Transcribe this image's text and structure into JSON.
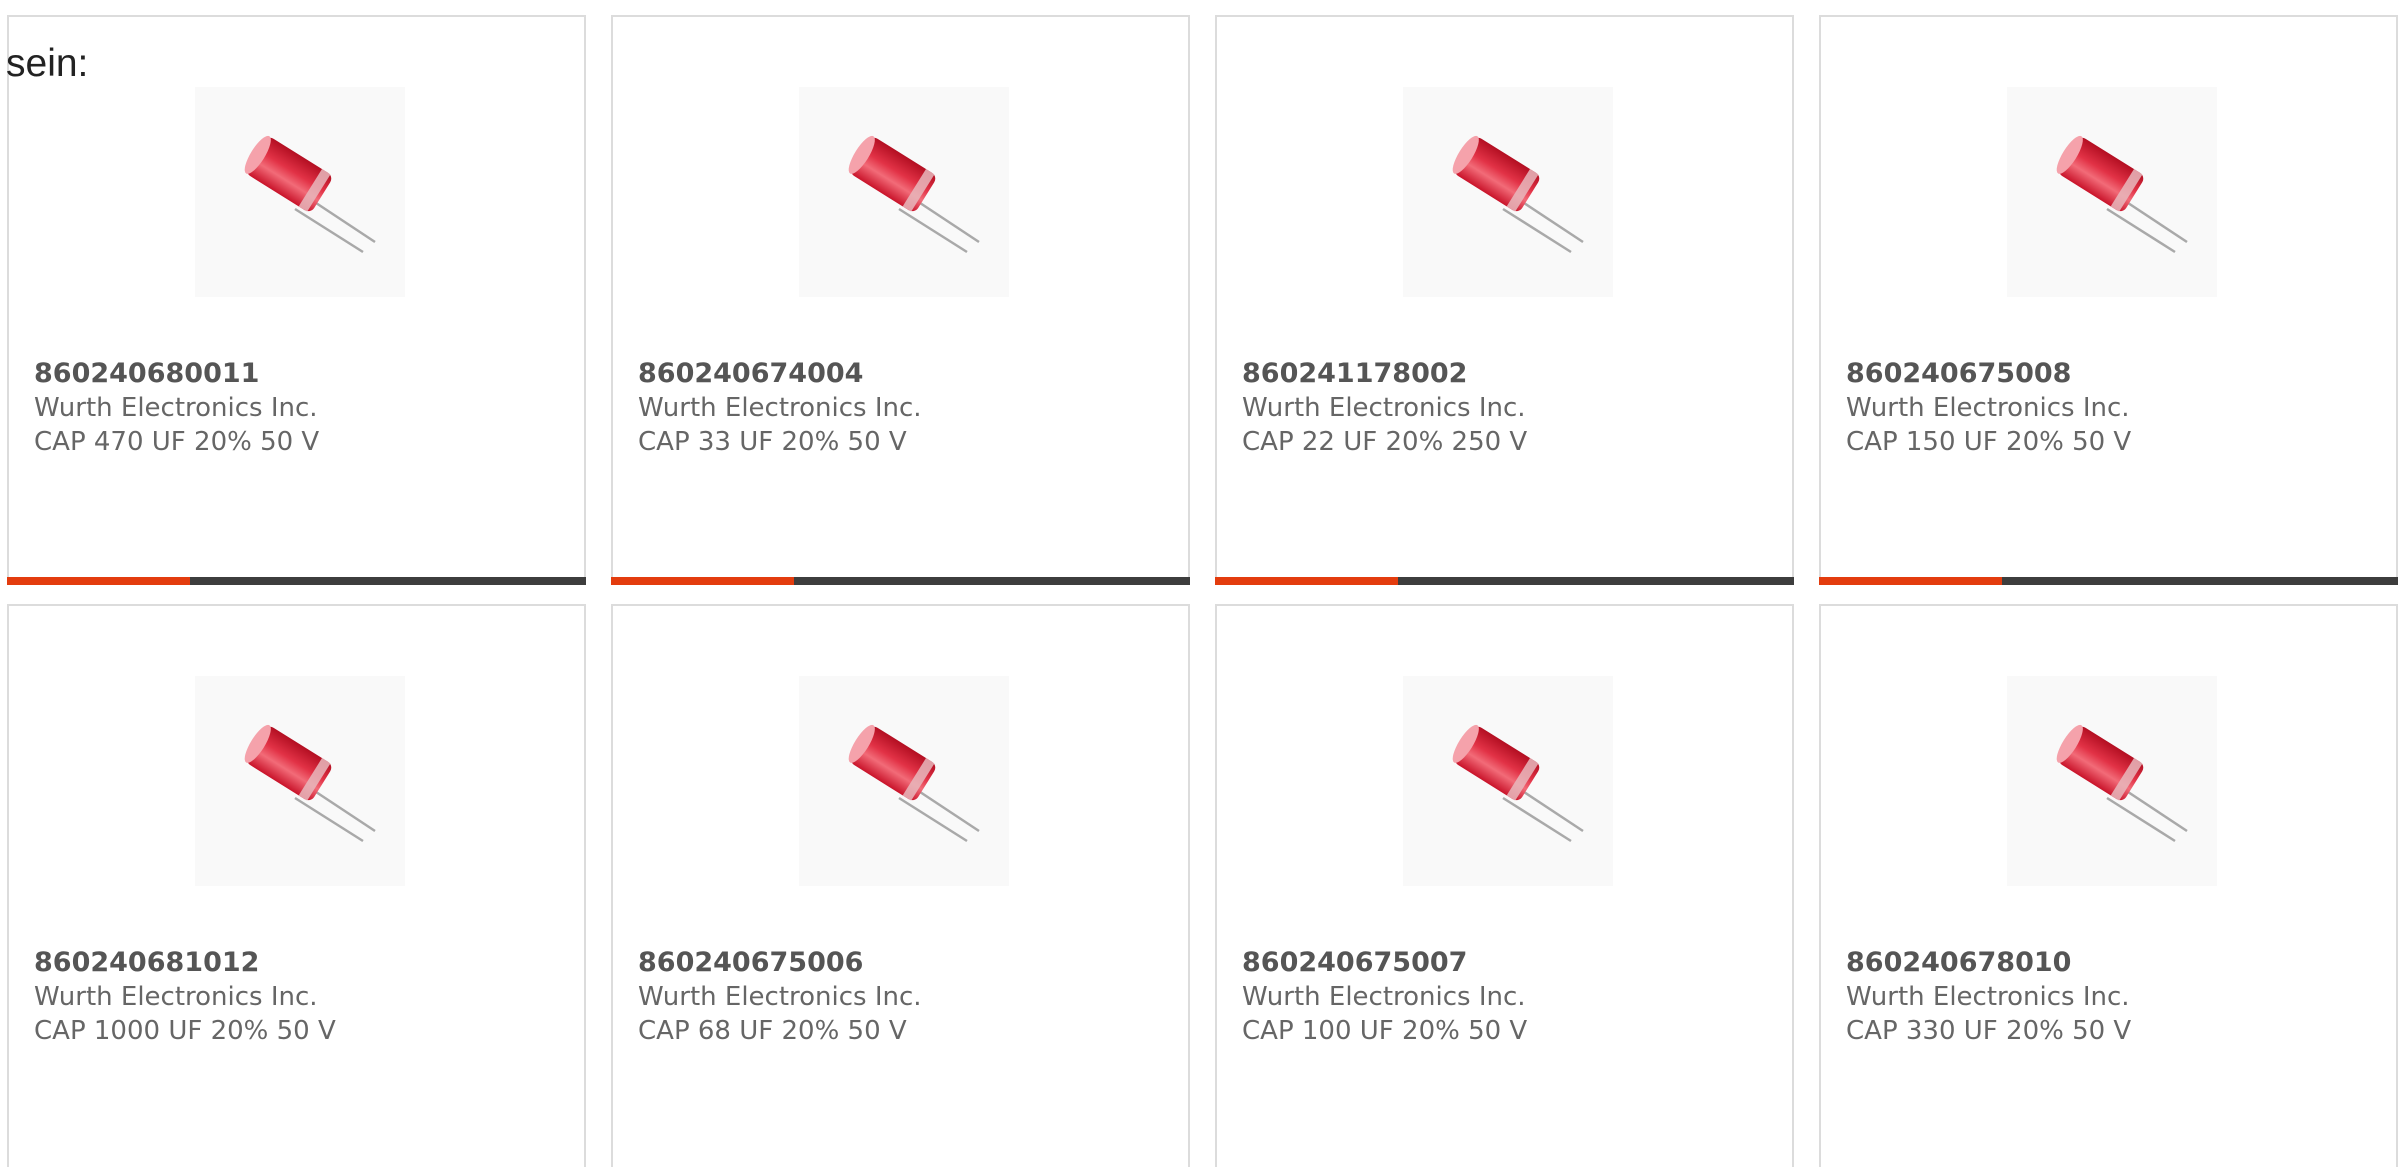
{
  "intro": {
    "text": "sein:"
  },
  "colors": {
    "accent": "#e33c0e",
    "bar": "#3d3d3d",
    "border": "#dcdcdc",
    "text": "#666666"
  },
  "products": [
    {
      "part_number": "860240680011",
      "manufacturer": "Wurth Electronics Inc.",
      "description": "CAP 470 UF 20% 50 V",
      "image_icon": "electrolytic-capacitor-icon"
    },
    {
      "part_number": "860240674004",
      "manufacturer": "Wurth Electronics Inc.",
      "description": "CAP 33 UF 20% 50 V",
      "image_icon": "electrolytic-capacitor-icon"
    },
    {
      "part_number": "860241178002",
      "manufacturer": "Wurth Electronics Inc.",
      "description": "CAP 22 UF 20% 250 V",
      "image_icon": "electrolytic-capacitor-icon"
    },
    {
      "part_number": "860240675008",
      "manufacturer": "Wurth Electronics Inc.",
      "description": "CAP 150 UF 20% 50 V",
      "image_icon": "electrolytic-capacitor-icon"
    },
    {
      "part_number": "860240681012",
      "manufacturer": "Wurth Electronics Inc.",
      "description": "CAP 1000 UF 20% 50 V",
      "image_icon": "electrolytic-capacitor-icon"
    },
    {
      "part_number": "860240675006",
      "manufacturer": "Wurth Electronics Inc.",
      "description": "CAP 68 UF 20% 50 V",
      "image_icon": "electrolytic-capacitor-icon"
    },
    {
      "part_number": "860240675007",
      "manufacturer": "Wurth Electronics Inc.",
      "description": "CAP 100 UF 20% 50 V",
      "image_icon": "electrolytic-capacitor-icon"
    },
    {
      "part_number": "860240678010",
      "manufacturer": "Wurth Electronics Inc.",
      "description": "CAP 330 UF 20% 50 V",
      "image_icon": "electrolytic-capacitor-icon"
    }
  ]
}
